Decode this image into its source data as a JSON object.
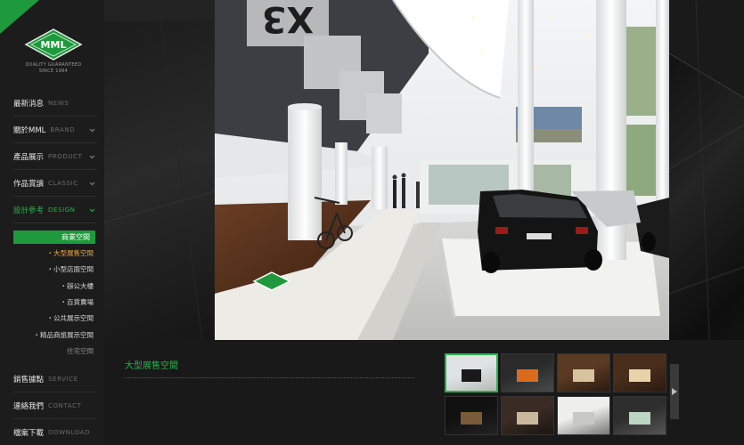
{
  "brand": {
    "logo_text": "MML",
    "tagline_line1": "QUALITY  GUARANTEED",
    "tagline_line2": "SINCE 1964",
    "accent": "#1e9a3c"
  },
  "nav": [
    {
      "zh": "最新消息",
      "en": "NEWS",
      "has_chevron": false,
      "active": false
    },
    {
      "zh": "關於MML",
      "en": "BRAND",
      "has_chevron": true,
      "active": false
    },
    {
      "zh": "產品展示",
      "en": "PRODUCT",
      "has_chevron": true,
      "active": false
    },
    {
      "zh": "作品賞讀",
      "en": "CLASSIC",
      "has_chevron": true,
      "active": false
    },
    {
      "zh": "設計參考",
      "en": "DESIGN",
      "has_chevron": true,
      "active": true
    },
    {
      "zh": "銷售據點",
      "en": "SERVICE",
      "has_chevron": false,
      "active": false
    },
    {
      "zh": "連絡我們",
      "en": "CONTACT",
      "has_chevron": false,
      "active": false
    },
    {
      "zh": "檔案下載",
      "en": "DOWNLOAD",
      "has_chevron": false,
      "active": false
    }
  ],
  "subnav": {
    "heading": "商業空間",
    "items": [
      {
        "label": "・大型展售空間",
        "state": "current"
      },
      {
        "label": "・小型店面空間",
        "state": "normal"
      },
      {
        "label": "・辦公大樓",
        "state": "normal"
      },
      {
        "label": "・百貨賣場",
        "state": "normal"
      },
      {
        "label": "・公共展示空間",
        "state": "normal"
      },
      {
        "label": "・精品商旅展示空間",
        "state": "normal"
      },
      {
        "label": "住宅空間",
        "state": "dim"
      }
    ]
  },
  "photo": {
    "banner_text": "X3"
  },
  "caption": {
    "title": "大型展售空間"
  },
  "thumbnails": [
    {
      "name": "thumb-showroom-bmw",
      "selected": true
    },
    {
      "name": "thumb-car-orange",
      "selected": false
    },
    {
      "name": "thumb-office-wood",
      "selected": false
    },
    {
      "name": "thumb-lamps",
      "selected": false
    },
    {
      "name": "thumb-dark-display",
      "selected": false
    },
    {
      "name": "thumb-corridor",
      "selected": false
    },
    {
      "name": "thumb-shop-white",
      "selected": false
    },
    {
      "name": "thumb-lounge",
      "selected": false
    }
  ],
  "icons": {
    "chevron": "chevron-down-icon",
    "next": "chevron-right-icon"
  }
}
